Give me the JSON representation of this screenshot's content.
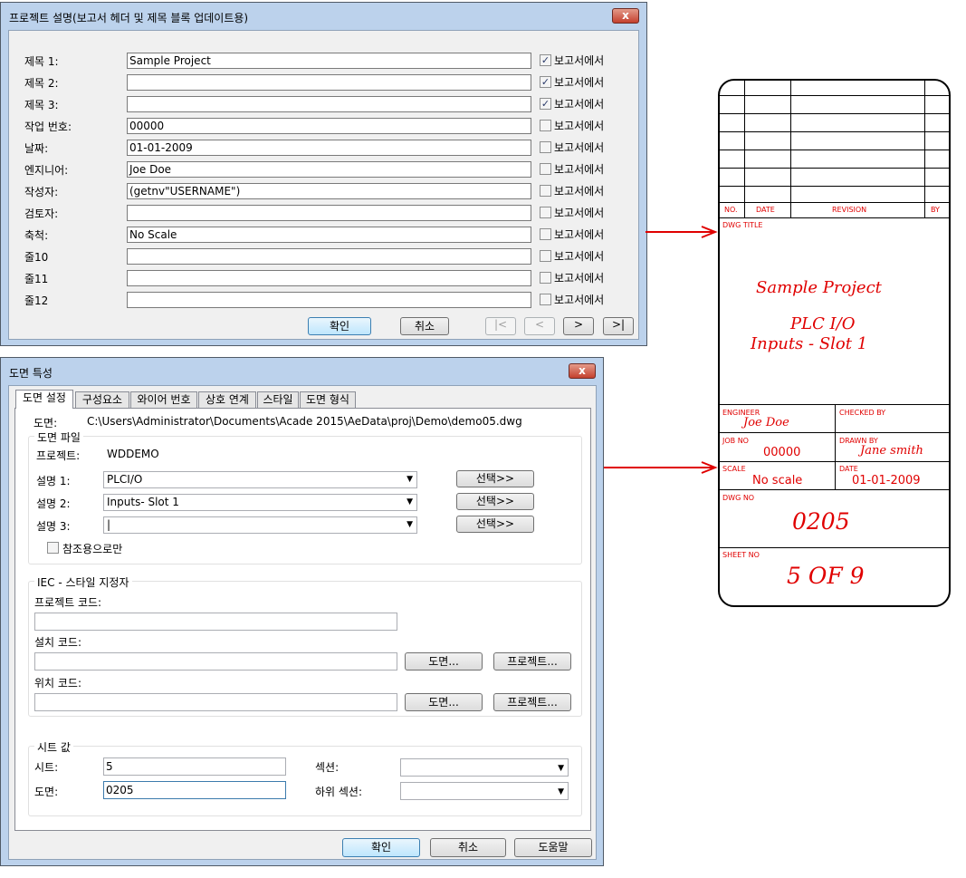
{
  "project_dialog": {
    "title": "프로젝트 설명(보고서 헤더 및 제목 블록 업데이트용)",
    "close_label": "x",
    "rows": [
      {
        "label": "제목 1:",
        "value": "Sample Project",
        "check_label": "보고서에서",
        "checked": "✓"
      },
      {
        "label": "제목 2:",
        "value": "",
        "check_label": "보고서에서",
        "checked": "✓"
      },
      {
        "label": "제목 3:",
        "value": "",
        "check_label": "보고서에서",
        "checked": "✓"
      },
      {
        "label": "작업 번호:",
        "value": "00000",
        "check_label": "보고서에서",
        "checked": ""
      },
      {
        "label": "날짜:",
        "value": "01-01-2009",
        "check_label": "보고서에서",
        "checked": ""
      },
      {
        "label": "엔지니어:",
        "value": "Joe Doe",
        "check_label": "보고서에서",
        "checked": ""
      },
      {
        "label": "작성자:",
        "value": "(getnv\"USERNAME\")",
        "check_label": "보고서에서",
        "checked": ""
      },
      {
        "label": "검토자:",
        "value": "",
        "check_label": "보고서에서",
        "checked": ""
      },
      {
        "label": "축척:",
        "value": "No Scale",
        "check_label": "보고서에서",
        "checked": ""
      },
      {
        "label": "줄10",
        "value": "",
        "check_label": "보고서에서",
        "checked": ""
      },
      {
        "label": "줄11",
        "value": "",
        "check_label": "보고서에서",
        "checked": ""
      },
      {
        "label": "줄12",
        "value": "",
        "check_label": "보고서에서",
        "checked": ""
      }
    ],
    "ok_label": "확인",
    "cancel_label": "취소",
    "nav": {
      "first": "|<",
      "prev": "<",
      "next": ">",
      "last": ">|"
    }
  },
  "drawing_dialog": {
    "title": "도면 특성",
    "close_label": "x",
    "tabs": [
      "도면 설정",
      "구성요소",
      "와이어 번호",
      "상호 연계",
      "스타일",
      "도면 형식"
    ],
    "drawing_label": "도면:",
    "drawing_path": "C:\\Users\\Administrator\\Documents\\Acade 2015\\AeData\\proj\\Demo\\demo05.dwg",
    "file_group": {
      "title": "도면 파일",
      "project_label": "프로젝트:",
      "project_value": "WDDEMO",
      "descriptions": [
        {
          "label": "설명 1:",
          "value": "PLCI/O",
          "button": "선택>>"
        },
        {
          "label": "설명 2:",
          "value": "Inputs- Slot 1",
          "button": "선택>>"
        },
        {
          "label": "설명 3:",
          "value": "|",
          "button": "선택>>"
        }
      ],
      "reference_only_label": "참조용으로만"
    },
    "iec_group": {
      "title": "IEC - 스타일 지정자",
      "project_code_label": "프로젝트 코드:",
      "install_code_label": "설치 코드:",
      "location_code_label": "위치 코드:",
      "drawing_button": "도면...",
      "project_button": "프로젝트..."
    },
    "sheet_group": {
      "title": "시트 값",
      "sheet_label": "시트:",
      "sheet_value": "5",
      "drawing_label": "도면:",
      "drawing_value": "0205",
      "section_label": "섹션:",
      "subsection_label": "하위 섹션:"
    },
    "ok_label": "확인",
    "cancel_label": "취소",
    "help_label": "도움말"
  },
  "title_block": {
    "headers": {
      "no": "NO.",
      "date": "DATE",
      "revision": "REVISION",
      "by": "BY"
    },
    "dwg_title_label": "DWG TITLE",
    "title_lines": [
      "Sample Project",
      "PLC I/O",
      "Inputs - Slot 1"
    ],
    "engineer_label": "ENGINEER",
    "engineer_value": "Joe Doe",
    "checked_by_label": "CHECKED BY",
    "job_no_label": "JOB NO",
    "job_no_value": "00000",
    "drawn_by_label": "DRAWN BY",
    "drawn_by_value": "Jane smith",
    "scale_label": "SCALE",
    "scale_value": "No scale",
    "date_label": "DATE",
    "date_value": "01-01-2009",
    "dwg_no_label": "DWG NO",
    "dwg_no_value": "0205",
    "sheet_no_label": "SHEET NO",
    "sheet_no_value": "5 OF 9"
  },
  "colors": {
    "arrow": "#e00000",
    "title_block_text": "#e00000",
    "window_frame": "#bcd2ec"
  }
}
